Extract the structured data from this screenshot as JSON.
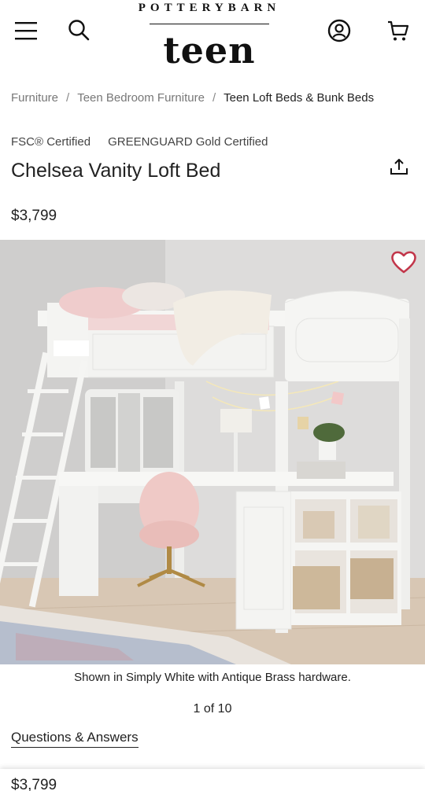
{
  "header": {
    "brand_top": "POTTERYBARN",
    "brand_main": "teen",
    "icons": [
      "menu-icon",
      "search-icon",
      "account-icon",
      "cart-icon"
    ]
  },
  "breadcrumb": {
    "items": [
      "Furniture",
      "Teen Bedroom Furniture",
      "Teen Loft Beds & Bunk Beds"
    ]
  },
  "product": {
    "certifications": [
      "FSC® Certified",
      "GREENGUARD Gold Certified"
    ],
    "title": "Chelsea Vanity Loft Bed",
    "price": "$3,799"
  },
  "gallery": {
    "caption": "Shown in Simply White with Antique Brass hardware.",
    "pager": "1 of 10"
  },
  "links": {
    "qa": "Questions & Answers"
  },
  "sticky_bar": {
    "price": "$3,799"
  },
  "colors": {
    "heart": "#c2364a",
    "text": "#222222",
    "muted": "#777777"
  }
}
